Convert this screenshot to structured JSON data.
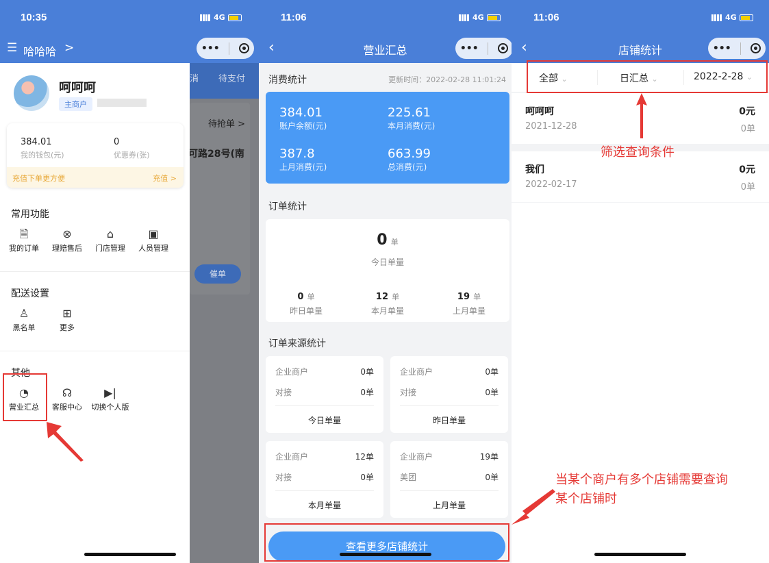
{
  "phone1": {
    "time": "10:35",
    "signal": "4G",
    "nav_title": "哈哈哈",
    "nav_chevron": ">",
    "behind_tabs": [
      "消",
      "待支付"
    ],
    "behind_grab": "待抢单 >",
    "behind_addr": "可路28号(南",
    "behind_btn": "催单",
    "user_name": "呵呵呵",
    "user_tag": "主商户",
    "wallet_value": "384.01",
    "wallet_label": "我的钱包(元)",
    "coupon_value": "0",
    "coupon_label": "优惠券(张)",
    "recharge_tip": "充值下单更方便",
    "recharge_btn": "充值 >",
    "common_title": "常用功能",
    "common_items": [
      {
        "label": "我的订单",
        "icon": "document-icon"
      },
      {
        "label": "理赔售后",
        "icon": "yen-icon"
      },
      {
        "label": "门店管理",
        "icon": "store-icon"
      },
      {
        "label": "人员管理",
        "icon": "contact-icon"
      }
    ],
    "delivery_title": "配送设置",
    "delivery_items": [
      {
        "label": "黑名单",
        "icon": "user-block-icon"
      },
      {
        "label": "更多",
        "icon": "grid-icon"
      }
    ],
    "other_title": "其他",
    "other_items": [
      {
        "label": "营业汇总",
        "icon": "pie-chart-icon"
      },
      {
        "label": "客服中心",
        "icon": "headset-icon"
      },
      {
        "label": "切换个人版",
        "icon": "skip-icon"
      }
    ]
  },
  "phone2": {
    "time": "11:06",
    "signal": "4G",
    "title": "营业汇总",
    "consume_title": "消费统计",
    "update_time": "更新时间：2022-02-28 11:01:24",
    "stats": [
      {
        "value": "384.01",
        "label": "账户余额(元)"
      },
      {
        "value": "225.61",
        "label": "本月消费(元)"
      },
      {
        "value": "387.8",
        "label": "上月消费(元)"
      },
      {
        "value": "663.99",
        "label": "总消费(元)"
      }
    ],
    "order_title": "订单统计",
    "today_count": "0",
    "unit": "单",
    "today_label": "今日单量",
    "order_sub": [
      {
        "value": "0",
        "label": "昨日单量"
      },
      {
        "value": "12",
        "label": "本月单量"
      },
      {
        "value": "19",
        "label": "上月单量"
      }
    ],
    "source_title": "订单来源统计",
    "source_cards": [
      {
        "rows": [
          {
            "name": "企业商户",
            "val": "0单"
          },
          {
            "name": "对接",
            "val": "0单"
          }
        ],
        "footer": "今日单量"
      },
      {
        "rows": [
          {
            "name": "企业商户",
            "val": "0单"
          },
          {
            "name": "对接",
            "val": "0单"
          }
        ],
        "footer": "昨日单量"
      },
      {
        "rows": [
          {
            "name": "企业商户",
            "val": "12单"
          },
          {
            "name": "对接",
            "val": "0单"
          }
        ],
        "footer": "本月单量"
      },
      {
        "rows": [
          {
            "name": "企业商户",
            "val": "19单"
          },
          {
            "name": "美团",
            "val": "0单"
          }
        ],
        "footer": "上月单量"
      }
    ],
    "more_button": "查看更多店铺统计"
  },
  "phone3": {
    "time": "11:06",
    "signal": "4G",
    "title": "店铺统计",
    "filters": [
      "全部",
      "日汇总",
      "2022-2-28"
    ],
    "stores": [
      {
        "name": "呵呵呵",
        "date": "2021-12-28",
        "amount": "0元",
        "orders": "0单"
      },
      {
        "name": "我们",
        "date": "2022-02-17",
        "amount": "0元",
        "orders": "0单"
      }
    ]
  },
  "annotations": {
    "filter_note": "筛选查询条件",
    "store_note_line1": "当某个商户有多个店铺需要查询",
    "store_note_line2": "某个店铺时"
  },
  "colors": {
    "primary": "#4a7fd8",
    "card_blue": "#4a9af5",
    "annotation": "#e53935"
  }
}
